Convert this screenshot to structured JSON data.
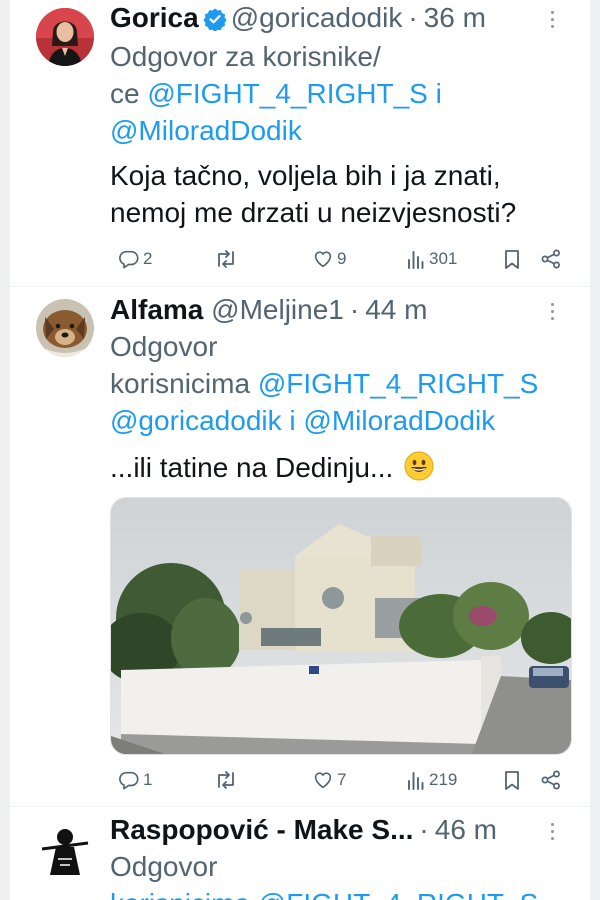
{
  "tweets": [
    {
      "name": "Gorica",
      "handle": "@goricadodik",
      "separator": "·",
      "time": "36 m",
      "reply_line1": "Odgovor za korisnike/",
      "reply_line2_prefix": "ce ",
      "mention1": "@FIGHT_4_RIGHT_S",
      "conj": " i",
      "mention2": "@MiloradDodik",
      "body_line1": "Koja tačno, voljela bih i ja znati,",
      "body_line2": "nemoj me drzati u neizvjesnosti?",
      "replies": "2",
      "retweets": "",
      "likes": "9",
      "views": "301"
    },
    {
      "name": "Alfama",
      "handle": "@Meljine1",
      "separator": "·",
      "time": "44 m",
      "reply_line1": "Odgovor",
      "reply_line2_prefix": "korisnicima ",
      "mention1": "@FIGHT_4_RIGHT_S",
      "mention2": "@goricadodik",
      "conj": " i ",
      "mention3": "@MiloradDodik",
      "body_line1": "...ili tatine na Dedinju...",
      "emoji": "😀",
      "replies": "1",
      "retweets": "",
      "likes": "7",
      "views": "219"
    },
    {
      "name": "Raspopović - Make S...",
      "separator": "·",
      "time": "46 m",
      "reply_line1": "Odgovor",
      "reply_line2_partial": "korisnicima @FIGHT_4_RIGHT_S"
    }
  ],
  "colors": {
    "link": "#1d9bf0",
    "secondary_text": "#536471",
    "verified_badge": "#1d9bf0",
    "background": "#ffffff"
  },
  "icons": [
    "reply-icon",
    "retweet-icon",
    "like-icon",
    "views-icon",
    "bookmark-icon",
    "share-icon",
    "verified-badge-icon",
    "more-options-icon"
  ]
}
